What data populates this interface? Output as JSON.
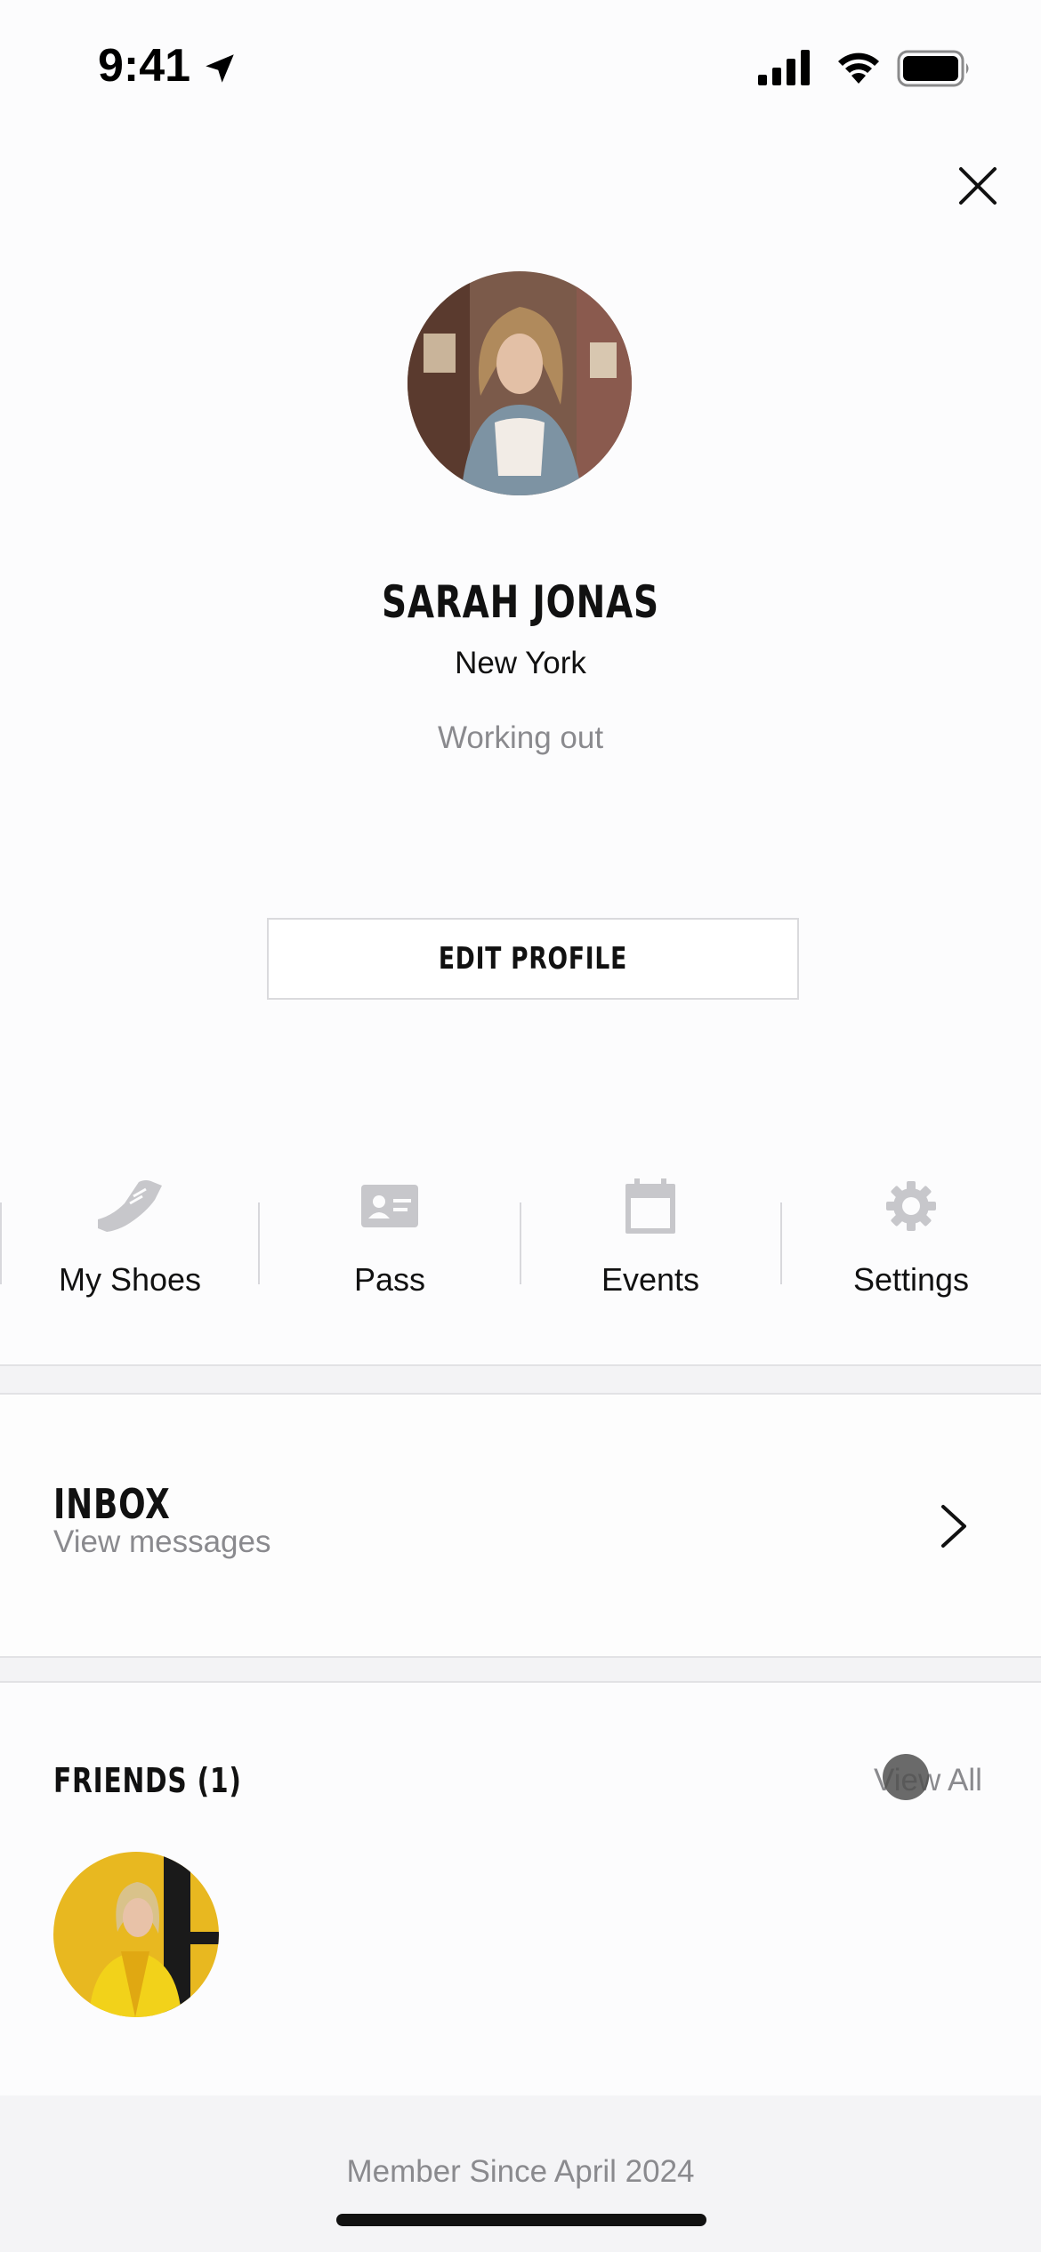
{
  "status_bar": {
    "time": "9:41"
  },
  "profile": {
    "name": "SARAH JONAS",
    "location": "New York",
    "status": "Working out",
    "edit_button": "EDIT PROFILE"
  },
  "quick_nav": {
    "items": [
      {
        "label": "My Shoes",
        "icon": "shoe-icon"
      },
      {
        "label": "Pass",
        "icon": "id-card-icon"
      },
      {
        "label": "Events",
        "icon": "calendar-icon"
      },
      {
        "label": "Settings",
        "icon": "gear-icon"
      }
    ]
  },
  "inbox": {
    "title": "INBOX",
    "subtitle": "View messages"
  },
  "friends": {
    "title": "FRIENDS (1)",
    "view_all": "View All"
  },
  "footer": {
    "member_since": "Member Since April 2024"
  },
  "colors": {
    "text_primary": "#111111",
    "text_secondary": "#8a8a8e",
    "icon_gray": "#c7c7cb",
    "background": "#fcfcfd",
    "separator": "#f3f3f5"
  }
}
